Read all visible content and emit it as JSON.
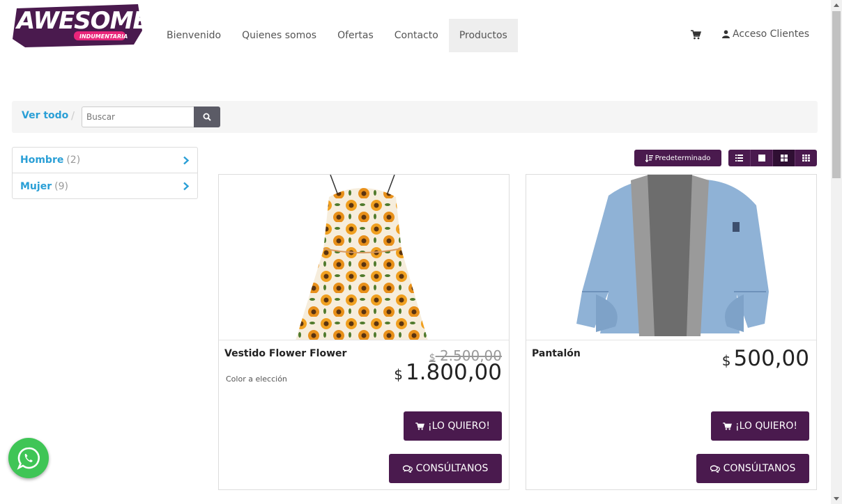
{
  "brand": {
    "logo_main": "AWESOME",
    "logo_sub": "INDUMENTARIA",
    "accent_color": "#4a1a4e",
    "logo_pink": "#e8257a"
  },
  "nav": {
    "items": [
      {
        "label": "Bienvenido"
      },
      {
        "label": "Quienes somos"
      },
      {
        "label": "Ofertas"
      },
      {
        "label": "Contacto"
      },
      {
        "label": "Productos",
        "active": true
      }
    ],
    "cart_icon": "cart-icon",
    "account_label": "Acceso Clientes",
    "account_icon": "user-icon"
  },
  "breadcrumb": {
    "ver_todo": "Ver todo",
    "separator": "/",
    "search_placeholder": "Buscar",
    "search_icon": "search-icon"
  },
  "sidebar": {
    "categories": [
      {
        "name": "Hombre",
        "count": "(2)"
      },
      {
        "name": "Mujer",
        "count": "(9)"
      }
    ]
  },
  "toolbar": {
    "sort_label": "Predeterminado",
    "sort_icon": "sort-icon",
    "views": [
      "list-view-icon",
      "single-view-icon",
      "grid-view-icon",
      "dense-grid-view-icon"
    ],
    "active_view": "grid-view-icon"
  },
  "products": [
    {
      "name": "Vestido Flower Flower",
      "description": "Color a elección",
      "old_price_currency": "$",
      "old_price": "2.500,00",
      "price_currency": "$",
      "price": "1.800,00",
      "buy_label": "¡LO QUIERO!",
      "consult_label": "CONSÚLTANOS"
    },
    {
      "name": "Pantalón",
      "price_currency": "$",
      "price": "500,00",
      "buy_label": "¡LO QUIERO!",
      "consult_label": "CONSÚLTANOS"
    }
  ],
  "whatsapp": {
    "icon": "whatsapp-icon",
    "color": "#3fc556"
  }
}
